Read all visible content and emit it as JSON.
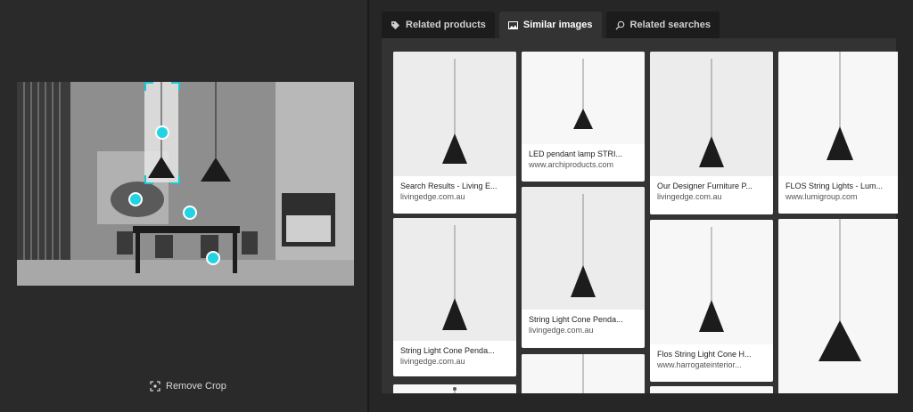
{
  "tabs": [
    {
      "label": "Related products",
      "icon": "tag-icon"
    },
    {
      "label": "Similar images",
      "icon": "image-icon"
    },
    {
      "label": "Related searches",
      "icon": "search-icon"
    }
  ],
  "active_tab": "Similar images",
  "left_panel": {
    "remove_crop_label": "Remove Crop"
  },
  "results": [
    {
      "title": "Search Results - Living E...",
      "source": "livingedge.com.au"
    },
    {
      "title": "LED pendant lamp STRI...",
      "source": "www.archiproducts.com"
    },
    {
      "title": "Our Designer Furniture P...",
      "source": "livingedge.com.au"
    },
    {
      "title": "FLOS String Lights - Lum...",
      "source": "www.lumigroup.com"
    },
    {
      "title": "String Light Cone Penda...",
      "source": "livingedge.com.au"
    },
    {
      "title": "String Light Cone Penda...",
      "source": "livingedge.com.au"
    },
    {
      "title": "Flos String Light Cone H...",
      "source": "www.harrogateinterior..."
    }
  ],
  "colors": {
    "accent": "#22d3e1",
    "panel_bg": "#2a2a2a",
    "tab_active": "#333333"
  }
}
